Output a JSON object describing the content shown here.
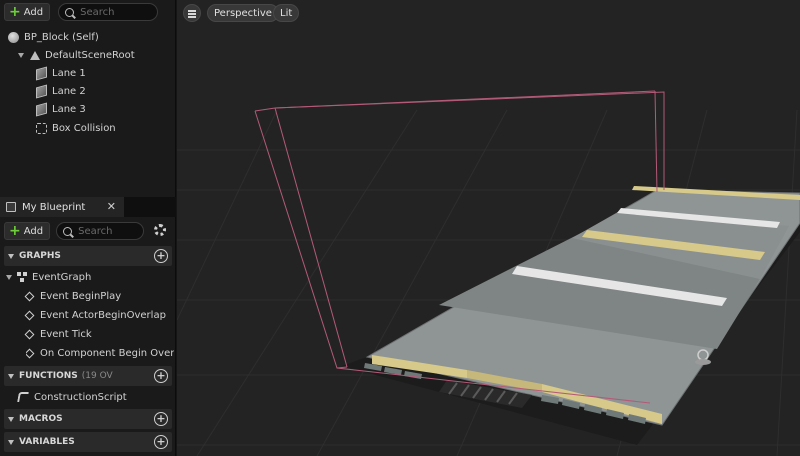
{
  "components": {
    "add_label": "Add",
    "search_placeholder": "Search",
    "items": [
      {
        "label": "BP_Block (Self)",
        "icon": "actor-sphere-icon"
      },
      {
        "label": "DefaultSceneRoot",
        "icon": "scene-root-icon"
      },
      {
        "label": "Lane 1",
        "icon": "static-mesh-icon"
      },
      {
        "label": "Lane 2",
        "icon": "static-mesh-icon"
      },
      {
        "label": "Lane 3",
        "icon": "static-mesh-icon"
      },
      {
        "label": "Box Collision",
        "icon": "box-collision-icon"
      }
    ]
  },
  "my_blueprint": {
    "tab_label": "My Blueprint",
    "close_glyph": "✕",
    "add_label": "Add",
    "search_placeholder": "Search",
    "graphs": {
      "label": "GRAPHS",
      "event_graph": "EventGraph",
      "events": [
        "Event BeginPlay",
        "Event ActorBeginOverlap",
        "Event Tick",
        "On Component Begin Overlap ("
      ]
    },
    "functions": {
      "label": "FUNCTIONS",
      "extra": "(19 OV",
      "items": [
        "ConstructionScript"
      ]
    },
    "macros": {
      "label": "MACROS"
    },
    "variables": {
      "label": "VARIABLES"
    }
  },
  "viewport": {
    "perspective_label": "Perspective",
    "lit_label": "Lit",
    "colors": {
      "background": "#232323",
      "grid": "#2e2e2e",
      "collision_wireframe": "#b35a78",
      "lane_surface": "#8f9495",
      "lane_stripe": "#e6e6e6",
      "curb_yellow": "#d6c98a"
    }
  }
}
